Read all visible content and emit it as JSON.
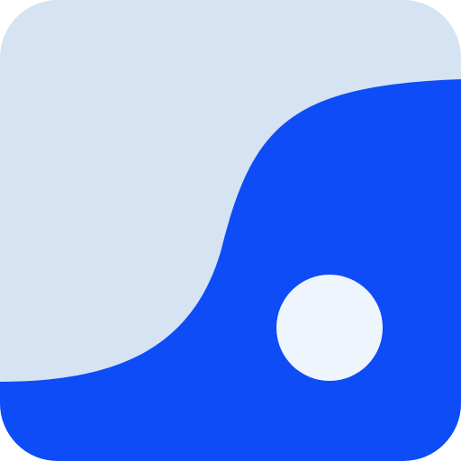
{
  "icon": {
    "name": "app-icon",
    "colors": {
      "tile_background": "#d5e3f2",
      "wave_fill": "#0d4cf7",
      "dot_fill": "#eef5fd"
    }
  }
}
